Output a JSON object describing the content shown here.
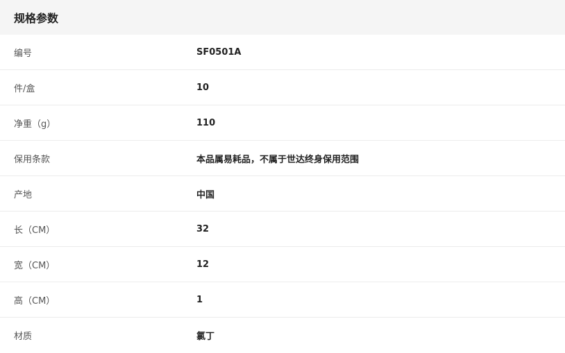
{
  "header": {
    "title": "规格参数"
  },
  "specs": [
    {
      "label": "编号",
      "value": "SF0501A"
    },
    {
      "label": "件/盒",
      "value": "10"
    },
    {
      "label": "净重（g）",
      "value": "110"
    },
    {
      "label": "保用条款",
      "value": "本品属易耗品，不属于世达终身保用范围"
    },
    {
      "label": "产地",
      "value": "中国"
    },
    {
      "label": "长（CM）",
      "value": "32"
    },
    {
      "label": "宽（CM）",
      "value": "12"
    },
    {
      "label": "高（CM）",
      "value": "1"
    },
    {
      "label": "材质",
      "value": "氯丁"
    }
  ]
}
